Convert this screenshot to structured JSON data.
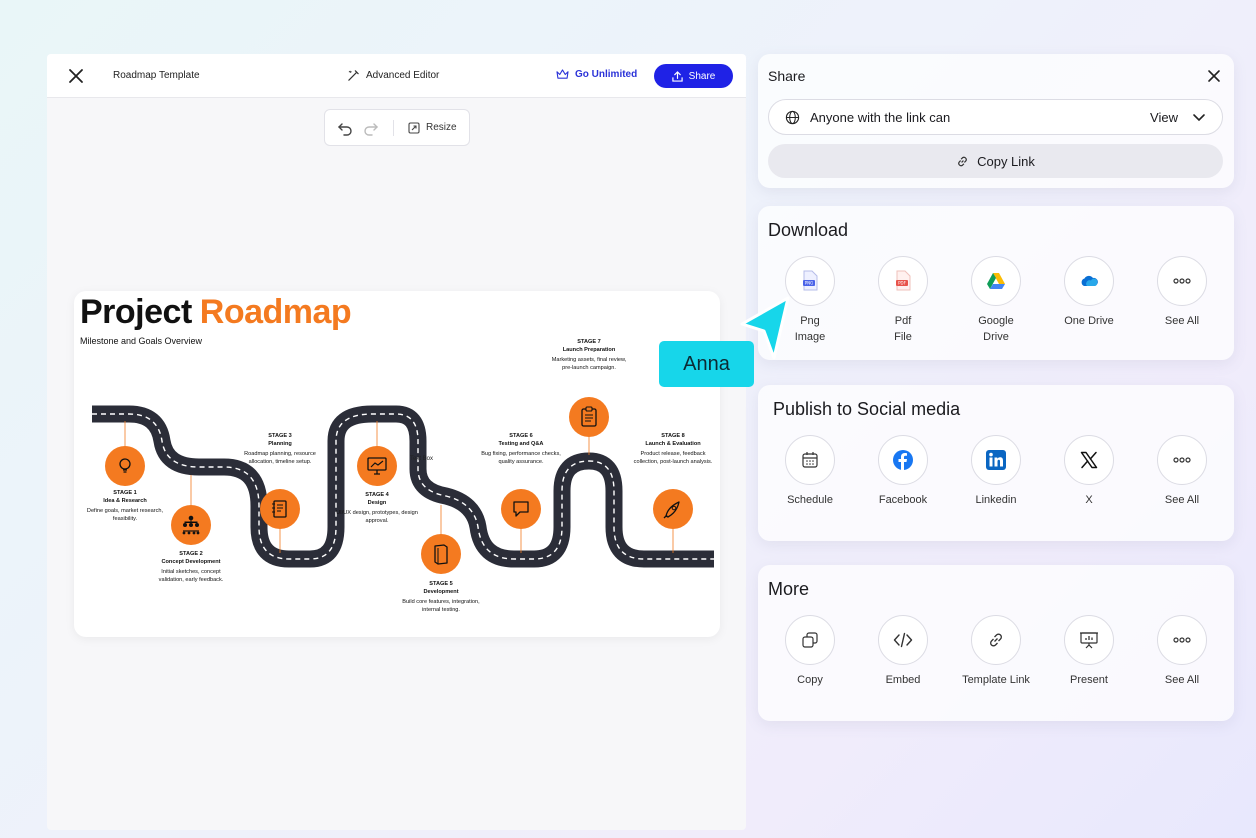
{
  "editor": {
    "doc_title": "Roadmap Template",
    "advanced_editor": "Advanced Editor",
    "go_unlimited": "Go Unlimited",
    "share": "Share",
    "resize": "Resize"
  },
  "roadmap": {
    "title_part1": "Project",
    "title_part2": "Roadmap",
    "subtitle": "Milestone and Goals Overview",
    "text_box": "Text Box",
    "stages": [
      {
        "num": "STAGE 1",
        "title": "Idea & Research",
        "desc": "Define goals, market research, feasibility."
      },
      {
        "num": "STAGE 2",
        "title": "Concept Development",
        "desc": "Initial sketches, concept validation, early feedback."
      },
      {
        "num": "STAGE 3",
        "title": "Planning",
        "desc": "Roadmap planning, resource allocation, timeline setup."
      },
      {
        "num": "STAGE 4",
        "title": "Design",
        "desc": "UI/UX design, prototypes, design approval."
      },
      {
        "num": "STAGE 5",
        "title": "Development",
        "desc": "Build core features, integration, internal testing."
      },
      {
        "num": "STAGE 6",
        "title": "Testing and Q&A",
        "desc": "Bug fixing, performance checks, quality assurance."
      },
      {
        "num": "STAGE 7",
        "title": "Launch Preparation",
        "desc": "Marketing assets, final review, pre-launch campaign."
      },
      {
        "num": "STAGE 8",
        "title": "Launch & Evaluation",
        "desc": "Product release, feedback collection, post-launch analysis."
      }
    ],
    "colors": {
      "accent": "#f47a20",
      "road": "#2b2d38"
    }
  },
  "share_panel": {
    "title": "Share",
    "access_label": "Anyone with the link can",
    "access_value": "View",
    "copy_link": "Copy Link"
  },
  "download_panel": {
    "title": "Download",
    "items": [
      "Png\nImage",
      "Pdf\nFile",
      "Google\nDrive",
      "One Drive",
      "See All"
    ]
  },
  "social_panel": {
    "title": "Publish to Social media",
    "items": [
      "Schedule",
      "Facebook",
      "Linkedin",
      "X",
      "See All"
    ]
  },
  "more_panel": {
    "title": "More",
    "items": [
      "Copy",
      "Embed",
      "Template Link",
      "Present",
      "See All"
    ]
  },
  "collaborator": {
    "name": "Anna",
    "color": "#17d6ea"
  },
  "colors": {
    "primary": "#1f22e6",
    "cursor": "#17d6ea"
  }
}
